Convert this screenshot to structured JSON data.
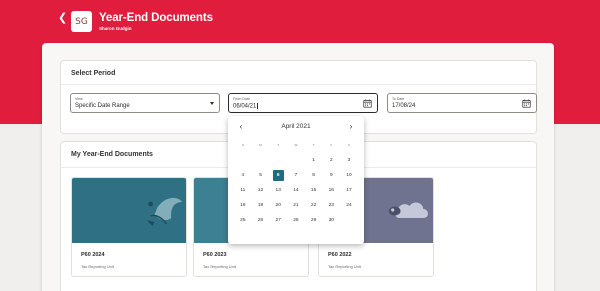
{
  "header": {
    "back_icon": "chevron-left-icon",
    "avatar_initials": "SG",
    "title": "Year-End Documents",
    "subtitle": "Sharon Gudgin"
  },
  "period": {
    "section_title": "Select Period",
    "view": {
      "label": "View",
      "value": "Specific Date Range",
      "icon": "chevron-down-icon"
    },
    "from_date": {
      "label": "From Date",
      "value": "06/04/21",
      "icon": "calendar-icon"
    },
    "to_date": {
      "label": "To Date",
      "value": "17/08/24",
      "icon": "calendar-icon"
    }
  },
  "documents": {
    "section_title": "My Year-End Documents",
    "cards": [
      {
        "title": "P60 2024",
        "subtitle": "Tax Reporting Unit",
        "color": "#2f7085"
      },
      {
        "title": "P60 2023",
        "subtitle": "Tax Reporting Unit",
        "color": "#3d7f93"
      },
      {
        "title": "P60 2022",
        "subtitle": "Tax Reporting Unit",
        "color": "#6f7390"
      }
    ]
  },
  "calendar": {
    "month_label": "April 2021",
    "prev_icon": "chevron-left-icon",
    "next_icon": "chevron-right-icon",
    "weekdays": [
      "S",
      "M",
      "T",
      "W",
      "T",
      "F",
      "S"
    ],
    "selected_day": "6",
    "weeks": [
      [
        "",
        "",
        "",
        "",
        "1",
        "2",
        "3"
      ],
      [
        "4",
        "5",
        "6",
        "7",
        "8",
        "9",
        "10"
      ],
      [
        "11",
        "12",
        "13",
        "14",
        "15",
        "16",
        "17"
      ],
      [
        "18",
        "19",
        "20",
        "21",
        "22",
        "23",
        "24"
      ],
      [
        "25",
        "26",
        "27",
        "28",
        "29",
        "30",
        ""
      ]
    ]
  },
  "colors": {
    "banner": "#e11d3d",
    "accent": "#1f6b82"
  }
}
